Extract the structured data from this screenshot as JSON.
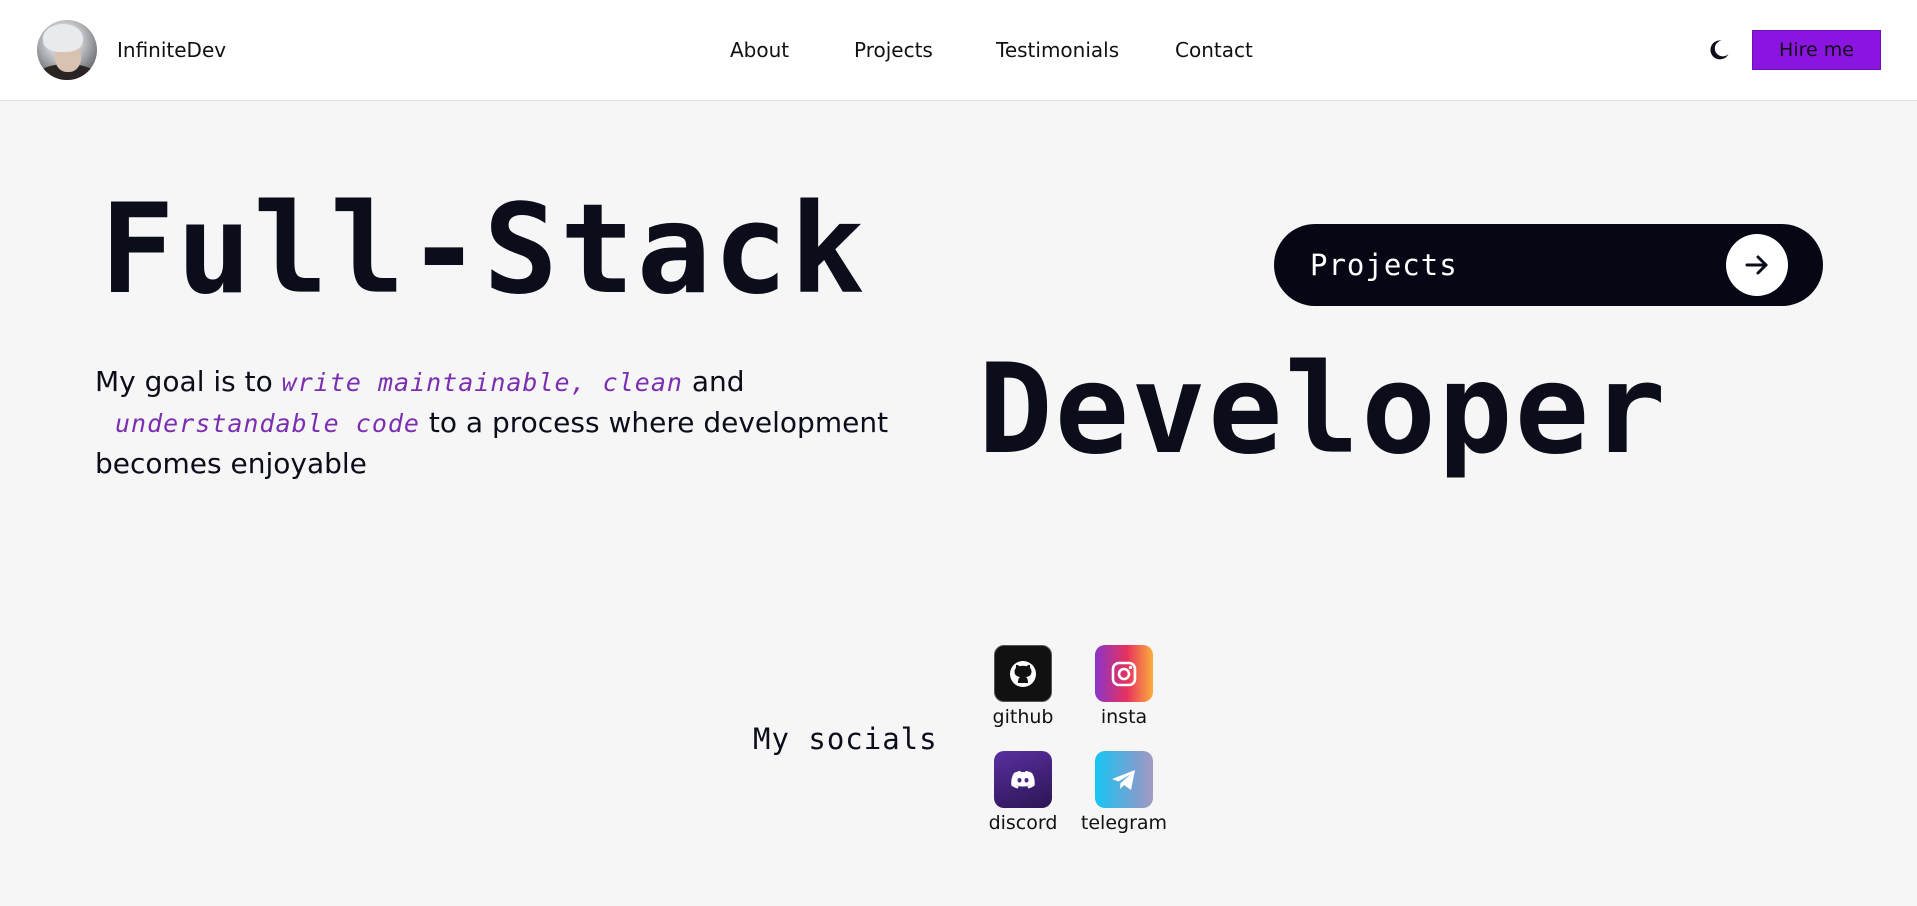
{
  "header": {
    "brand": "InfiniteDev",
    "nav": [
      {
        "label": "About"
      },
      {
        "label": "Projects"
      },
      {
        "label": "Testimonials"
      },
      {
        "label": "Contact"
      }
    ],
    "theme_toggle_icon": "moon-icon",
    "hire_label": "Hire me"
  },
  "hero": {
    "title_line1": "Full-Stack",
    "title_line2": "Developer",
    "projects_button": "Projects",
    "projects_icon": "arrow-right-icon",
    "goal": {
      "part1": "My goal is to ",
      "code1": "write maintainable, clean",
      "part2": " and ",
      "code2": "understandable code",
      "part3": " to a process where development becomes enjoyable"
    }
  },
  "socials": {
    "heading": "My socials",
    "items": [
      {
        "label": "github",
        "icon": "github-icon"
      },
      {
        "label": "insta",
        "icon": "instagram-icon"
      },
      {
        "label": "discord",
        "icon": "discord-icon"
      },
      {
        "label": "telegram",
        "icon": "telegram-icon"
      }
    ]
  },
  "colors": {
    "accent": "#8a14e0",
    "code_text": "#7b2fb0",
    "dark": "#050814",
    "background": "#f6f6f6"
  }
}
